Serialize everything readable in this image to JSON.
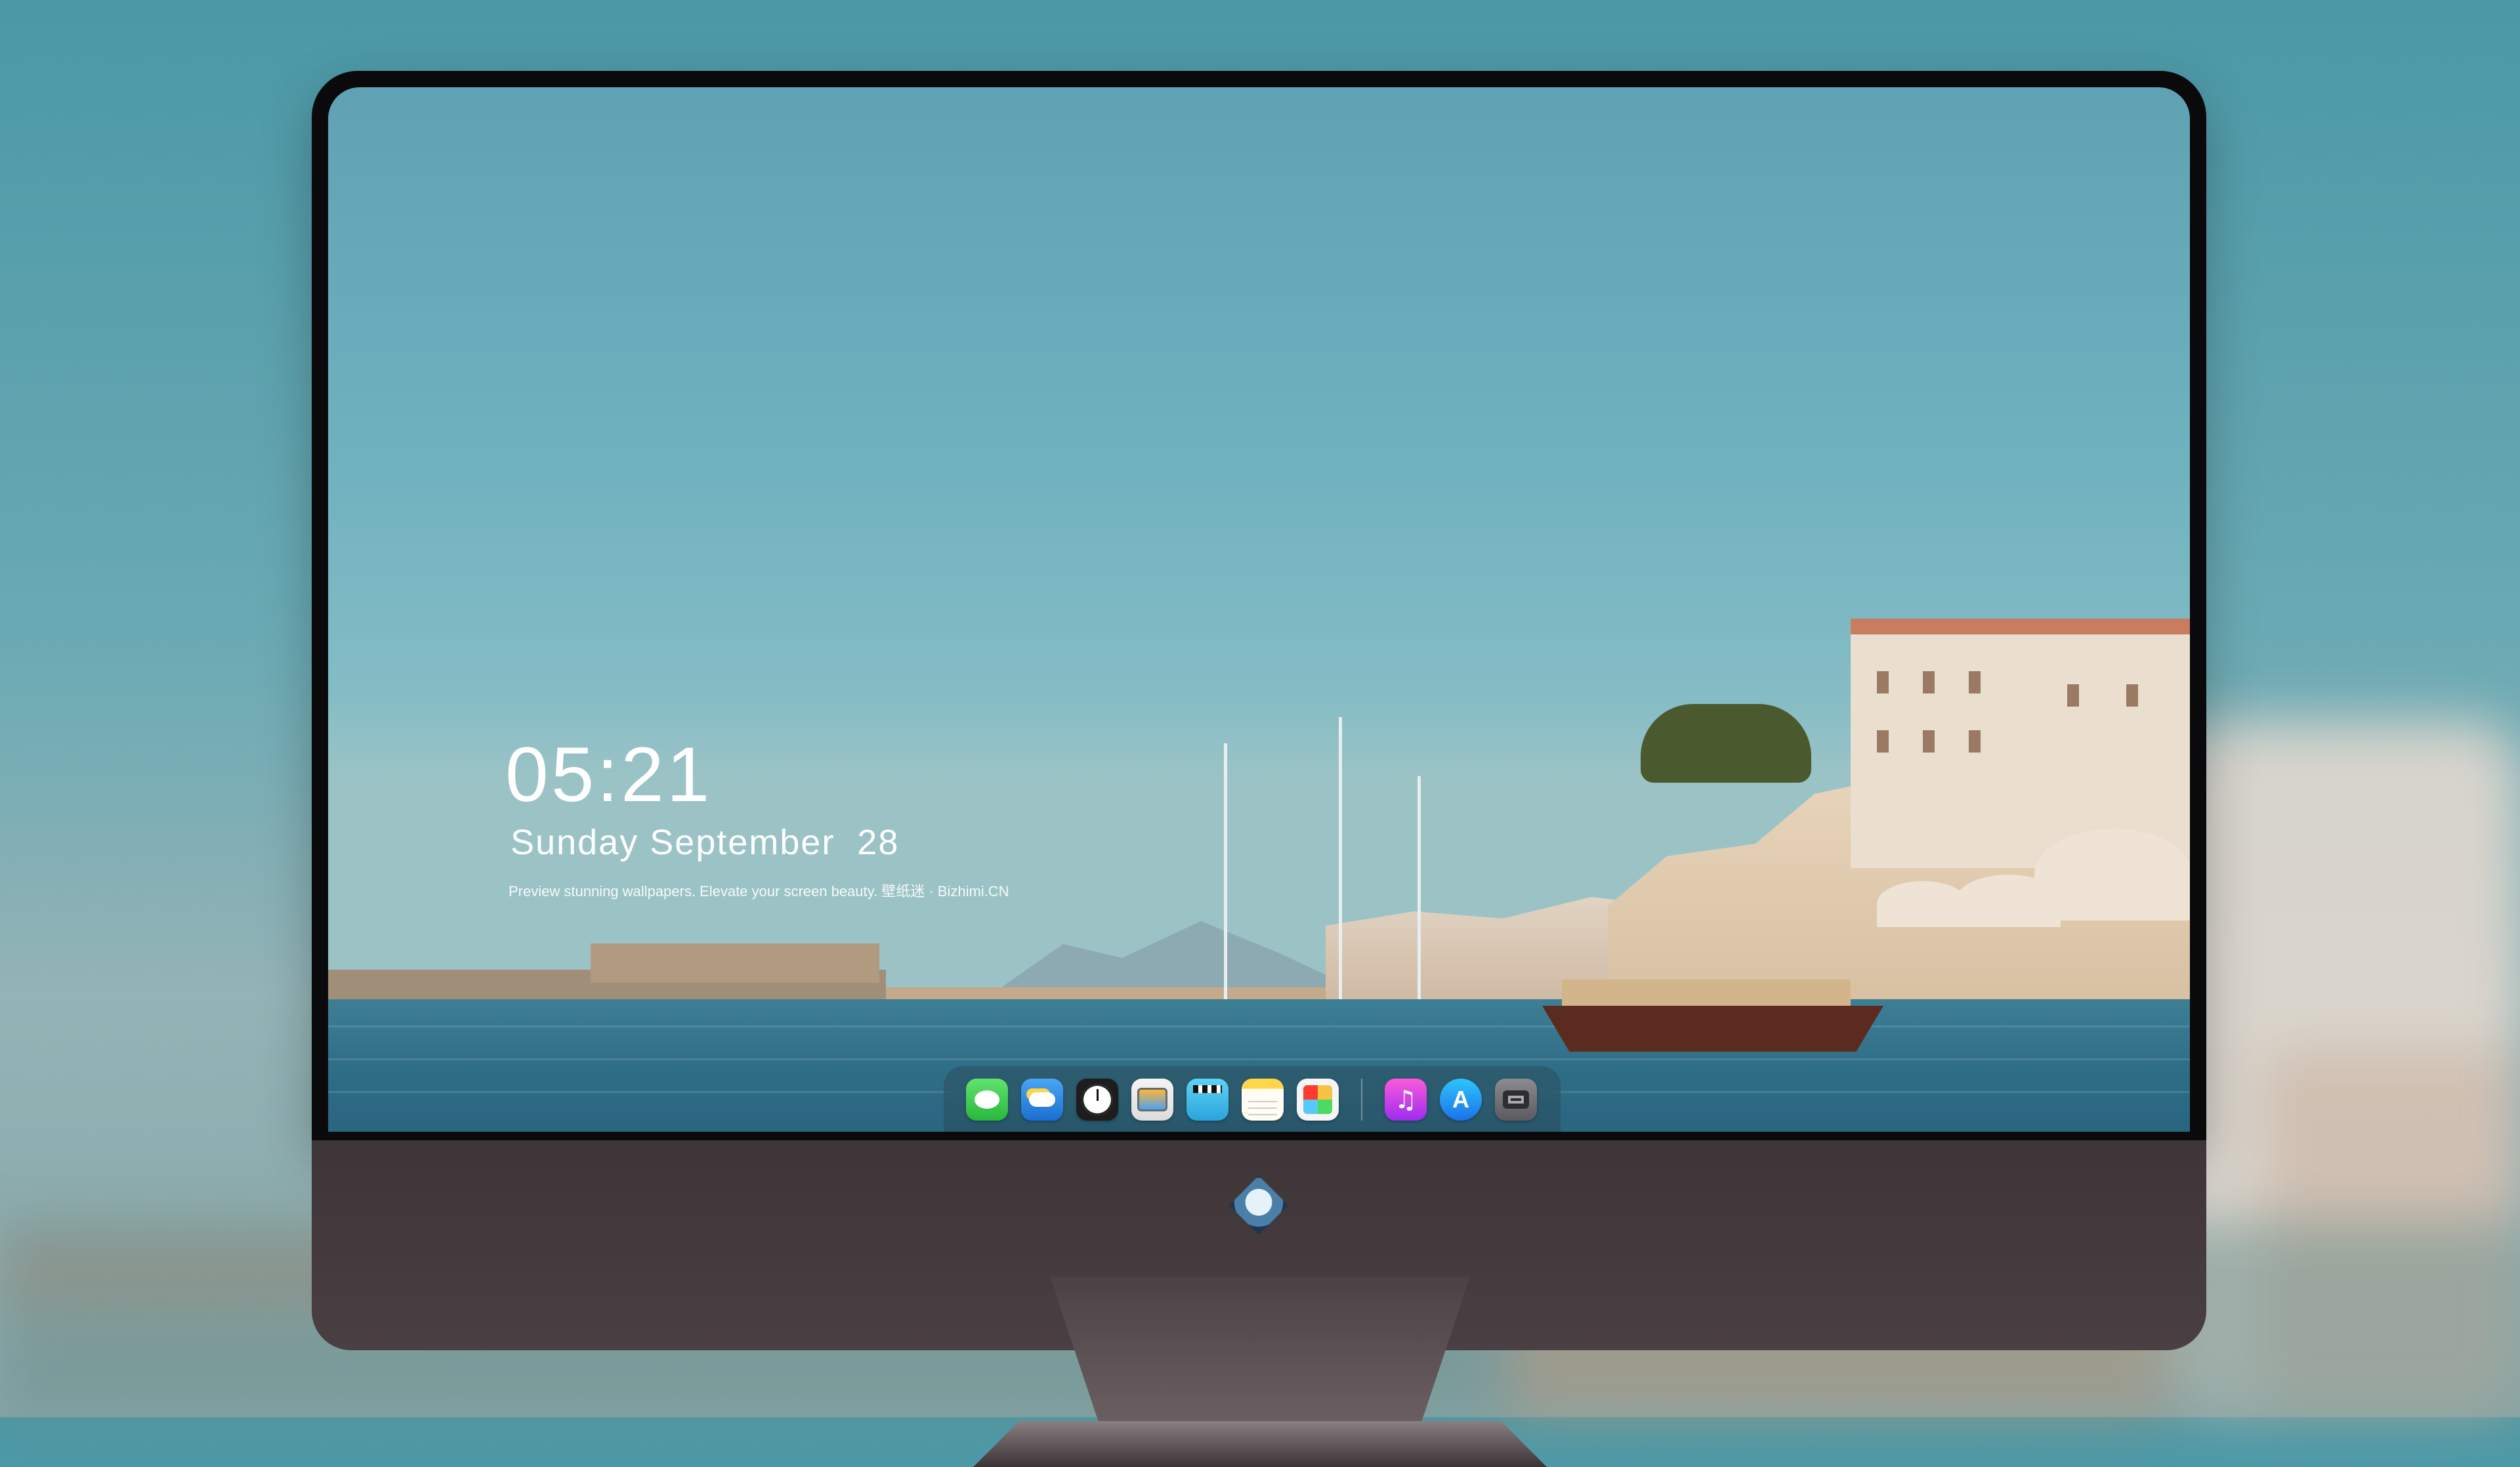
{
  "desktop": {
    "clock": {
      "time": "05:21",
      "date": "Sunday September  28"
    },
    "tagline": "Preview stunning wallpapers. Elevate your screen beauty. 壁纸迷 · Bizhimi.CN"
  },
  "dock": {
    "apps": [
      {
        "name": "Messages",
        "icon": "messages-icon"
      },
      {
        "name": "Weather",
        "icon": "weather-icon"
      },
      {
        "name": "Clock",
        "icon": "clock-icon"
      },
      {
        "name": "Preview",
        "icon": "preview-icon"
      },
      {
        "name": "Clips",
        "icon": "clips-icon"
      },
      {
        "name": "Notes",
        "icon": "notes-icon"
      },
      {
        "name": "Photos",
        "icon": "photos-icon"
      },
      {
        "name": "Music",
        "icon": "music-icon"
      },
      {
        "name": "App Store",
        "icon": "app-store-icon"
      },
      {
        "name": "Camera",
        "icon": "camera-icon"
      }
    ]
  },
  "colors": {
    "sky": "#6fb1bf",
    "sea": "#2f6e87",
    "bezel": "#0a0a0c",
    "chin": "#433a3d"
  }
}
